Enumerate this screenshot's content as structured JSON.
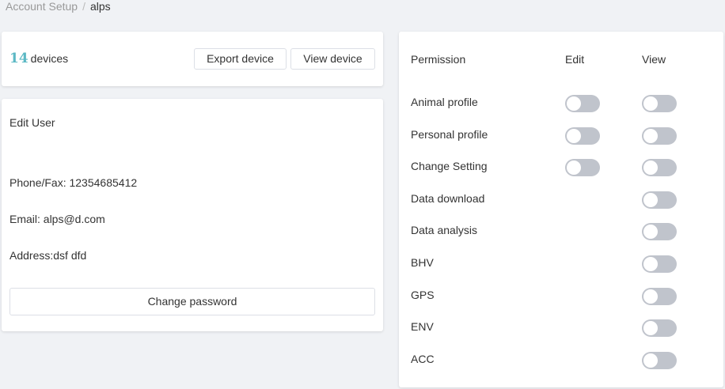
{
  "breadcrumb": {
    "root": "Account Setup",
    "separator": "/",
    "current": "alps"
  },
  "devices": {
    "count": "14",
    "unit_label": "devices",
    "export_button": "Export device",
    "view_button": "View device"
  },
  "user": {
    "title": "Edit User",
    "phone": "Phone/Fax: 12354685412",
    "email": "Email: alps@d.com",
    "address": "Address:dsf dfd",
    "change_password_button": "Change password"
  },
  "permissions": {
    "headers": {
      "name": "Permission",
      "edit": "Edit",
      "view": "View"
    },
    "rows": [
      {
        "label": "Animal profile",
        "edit": false,
        "view": false
      },
      {
        "label": "Personal profile",
        "edit": false,
        "view": false
      },
      {
        "label": "Change Setting",
        "edit": false,
        "view": false
      },
      {
        "label": "Data download",
        "edit": null,
        "view": false
      },
      {
        "label": "Data analysis",
        "edit": null,
        "view": false
      },
      {
        "label": "BHV",
        "edit": null,
        "view": false
      },
      {
        "label": "GPS",
        "edit": null,
        "view": false
      },
      {
        "label": "ENV",
        "edit": null,
        "view": false
      },
      {
        "label": "ACC",
        "edit": null,
        "view": false
      }
    ]
  },
  "colors": {
    "accent": "#5bb8c4",
    "toggle_off": "#c0c4cc",
    "background": "#f0f2f5"
  }
}
